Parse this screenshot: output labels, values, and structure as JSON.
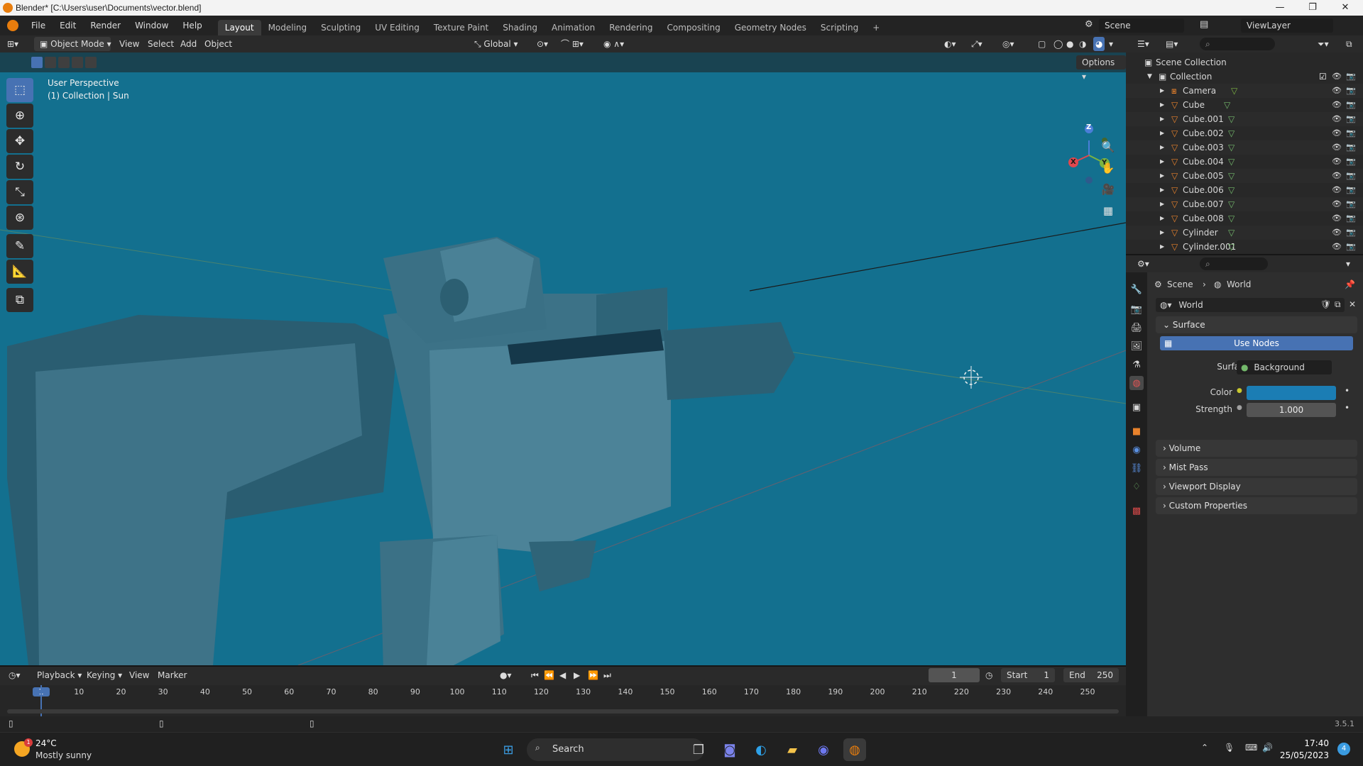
{
  "window": {
    "title": "Blender* [C:\\Users\\user\\Documents\\vector.blend]",
    "minimize": "—",
    "maximize": "❐",
    "close": "✕"
  },
  "menu": [
    "File",
    "Edit",
    "Render",
    "Window",
    "Help"
  ],
  "workspaces": [
    "Layout",
    "Modeling",
    "Sculpting",
    "UV Editing",
    "Texture Paint",
    "Shading",
    "Animation",
    "Rendering",
    "Compositing",
    "Geometry Nodes",
    "Scripting",
    "+"
  ],
  "scene": {
    "label": "Scene",
    "view_layer": "ViewLayer"
  },
  "viewport_header": {
    "mode": "Object Mode",
    "view": "View",
    "select": "Select",
    "add": "Add",
    "object": "Object",
    "transform": "Global",
    "options": "Options"
  },
  "viewport": {
    "perspective": "User Perspective",
    "collection": "(1) Collection | Sun",
    "gizmo_z": "Z",
    "gizmo_y": "Y",
    "gizmo_x": "X"
  },
  "outliner": {
    "root": "Scene Collection",
    "collection": "Collection",
    "items": [
      "Camera",
      "Cube",
      "Cube.001",
      "Cube.002",
      "Cube.003",
      "Cube.004",
      "Cube.005",
      "Cube.006",
      "Cube.007",
      "Cube.008",
      "Cylinder",
      "Cylinder.001"
    ]
  },
  "properties": {
    "breadcrumb_scene": "Scene",
    "breadcrumb_world": "World",
    "world_name": "World",
    "surface_panel": "Surface",
    "use_nodes": "Use Nodes",
    "surface_label": "Surface",
    "surface_value": "Background",
    "color_label": "Color",
    "color_value": "#1b7db4",
    "strength_label": "Strength",
    "strength_value": "1.000",
    "panels": [
      "Volume",
      "Mist Pass",
      "Viewport Display",
      "Custom Properties"
    ]
  },
  "timeline": {
    "playback": "Playback",
    "keying": "Keying",
    "view": "View",
    "marker": "Marker",
    "current_frame": "1",
    "start_label": "Start",
    "start": "1",
    "end_label": "End",
    "end": "250",
    "ticks": [
      "1",
      "10",
      "20",
      "30",
      "40",
      "50",
      "60",
      "70",
      "80",
      "90",
      "100",
      "110",
      "120",
      "130",
      "140",
      "150",
      "160",
      "170",
      "180",
      "190",
      "200",
      "210",
      "220",
      "230",
      "240",
      "250"
    ]
  },
  "status": {
    "version": "3.5.1"
  },
  "taskbar": {
    "weather_temp": "24°C",
    "weather_desc": "Mostly sunny",
    "weather_badge": "1",
    "search": "Search",
    "time": "17:40",
    "date": "25/05/2023",
    "notif": "4"
  }
}
